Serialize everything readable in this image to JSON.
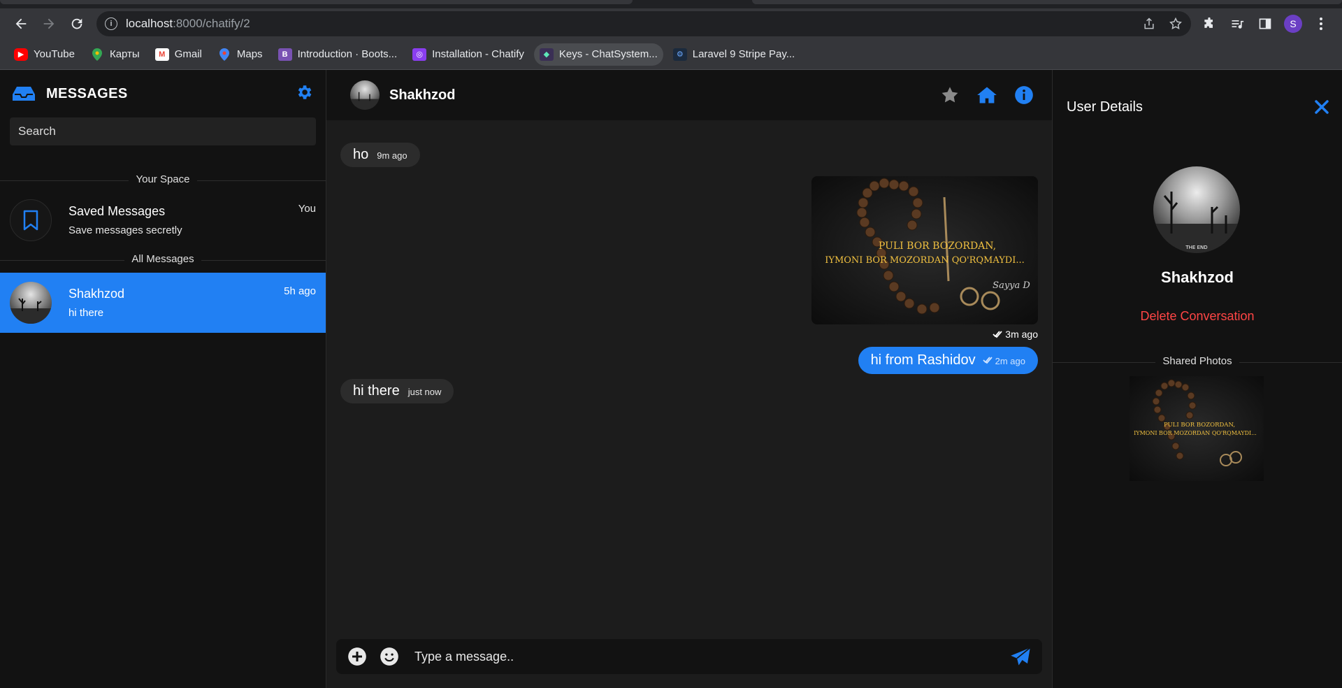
{
  "browser": {
    "url_host": "localhost",
    "url_path": ":8000/chatify/2",
    "profile_initial": "S",
    "bookmarks": [
      {
        "label": "YouTube",
        "color": "#ff0000",
        "glyph": "▶"
      },
      {
        "label": "Карты",
        "color": "#34a853",
        "glyph": "●"
      },
      {
        "label": "Gmail",
        "color": "#ea4335",
        "glyph": "M"
      },
      {
        "label": "Maps",
        "color": "#4285f4",
        "glyph": "●"
      },
      {
        "label": "Introduction · Boots...",
        "color": "#7952b3",
        "glyph": "B"
      },
      {
        "label": "Installation - Chatify",
        "color": "#8a3ef0",
        "glyph": "◎"
      },
      {
        "label": "Keys - ChatSystem...",
        "color": "#3a2f55",
        "glyph": "◆"
      },
      {
        "label": "Laravel 9 Stripe Pay...",
        "color": "#1b2a3d",
        "glyph": "⚙"
      }
    ]
  },
  "sidebar": {
    "title": "MESSAGES",
    "search_placeholder": "Search",
    "your_space_label": "Your Space",
    "all_messages_label": "All Messages",
    "saved": {
      "name": "Saved Messages",
      "sub": "Save messages secretly",
      "time": "You"
    },
    "contacts": [
      {
        "name": "Shakhzod",
        "last": "hi there",
        "time": "5h ago"
      }
    ]
  },
  "chat": {
    "contact_name": "Shakhzod",
    "messages": [
      {
        "dir": "in",
        "text": "ho",
        "time": "9m ago"
      },
      {
        "dir": "out-image",
        "image_text_line1": "PULI BOR BOZORDAN,",
        "image_text_line2": "IYMONI BOR MOZORDAN QO'RQMAYDI...",
        "signature": "Sayya D",
        "time": "3m ago"
      },
      {
        "dir": "out",
        "text": "hi from Rashidov",
        "time": "2m ago"
      },
      {
        "dir": "in",
        "text": "hi there",
        "time": "just now"
      }
    ],
    "composer_placeholder": "Type a message.."
  },
  "details": {
    "title": "User Details",
    "avatar_caption": "THE END",
    "name": "Shakhzod",
    "delete_label": "Delete Conversation",
    "shared_label": "Shared Photos"
  },
  "colors": {
    "accent": "#2180f3",
    "danger": "#ff4545",
    "bg": "#121212",
    "chat_bg": "#1c1c1c"
  }
}
